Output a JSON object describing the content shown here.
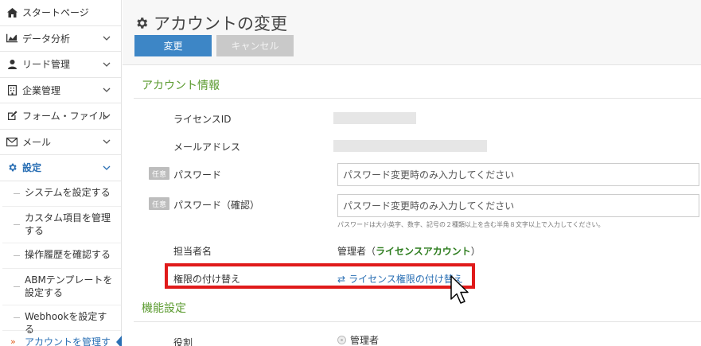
{
  "sidebar": {
    "items": [
      {
        "label": "スタートページ",
        "icon": "home-icon"
      },
      {
        "label": "データ分析",
        "icon": "chart-icon"
      },
      {
        "label": "リード管理",
        "icon": "user-icon"
      },
      {
        "label": "企業管理",
        "icon": "building-icon"
      },
      {
        "label": "フォーム・ファイル",
        "icon": "edit-icon"
      },
      {
        "label": "メール",
        "icon": "mail-icon"
      },
      {
        "label": "設定",
        "icon": "gear-icon"
      }
    ],
    "sub_items": [
      {
        "label": "システムを設定する"
      },
      {
        "label": "カスタム項目を管理する"
      },
      {
        "label": "操作履歴を確認する"
      },
      {
        "label": "ABMテンプレートを設定する"
      },
      {
        "label": "Webhookを設定する"
      },
      {
        "label": "アカウントを管理する"
      }
    ],
    "current_marker": "»"
  },
  "header": {
    "title": "アカウントの変更",
    "save_label": "変更",
    "cancel_label": "キャンセル"
  },
  "account_info": {
    "section_title": "アカウント情報",
    "license_id_label": "ライセンスID",
    "email_label": "メールアドレス",
    "optional_tag": "任意",
    "password_label": "パスワード",
    "password_confirm_label": "パスワード（確認）",
    "password_placeholder": "パスワード変更時のみ入力してください",
    "password_confirm_placeholder": "パスワード変更時のみ入力してください",
    "password_help": "パスワードは大小英字、数字、記号の２種類以上を含む半角８文字以上で入力してください。",
    "owner_label": "担当者名",
    "owner_value_prefix": "管理者（",
    "owner_value_bold": "ライセンスアカウント",
    "owner_value_suffix": "）",
    "transfer_label": "権限の付け替え",
    "transfer_link": "ライセンス権限の付け替え"
  },
  "features": {
    "section_title": "機能設定",
    "role_label": "役割",
    "role_option": "管理者"
  },
  "colors": {
    "primary": "#3d86c6",
    "section_green": "#5a9a2e",
    "highlight_red": "#e01a1a",
    "link_blue": "#2a6fb4"
  }
}
